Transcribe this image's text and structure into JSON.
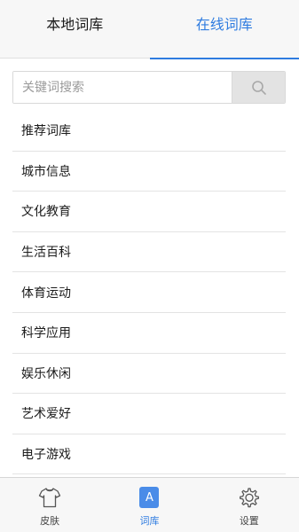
{
  "tabs": [
    {
      "label": "本地词库",
      "active": false
    },
    {
      "label": "在线词库",
      "active": true
    }
  ],
  "search": {
    "placeholder": "关键词搜索",
    "value": ""
  },
  "categories": [
    "推荐词库",
    "城市信息",
    "文化教育",
    "生活百科",
    "体育运动",
    "科学应用",
    "娱乐休闲",
    "艺术爱好",
    "电子游戏"
  ],
  "bottom_nav": [
    {
      "label": "皮肤",
      "icon": "tshirt-icon",
      "active": false
    },
    {
      "label": "词库",
      "icon": "lexicon-icon",
      "icon_text": "A",
      "active": true
    },
    {
      "label": "设置",
      "icon": "gear-icon",
      "active": false
    }
  ],
  "colors": {
    "accent": "#2f7ce0",
    "tab_background": "#f7f7f7",
    "search_button": "#e3e3e3"
  }
}
